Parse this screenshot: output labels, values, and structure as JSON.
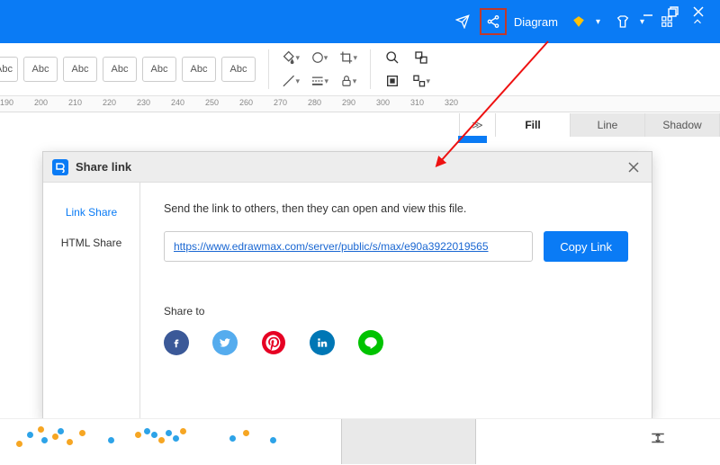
{
  "titlebar": {
    "diagram_label": "Diagram"
  },
  "toolbar": {
    "abc_label": "Abc"
  },
  "ruler": {
    "ticks": [
      "190",
      "200",
      "210",
      "220",
      "230",
      "240",
      "250",
      "260",
      "270",
      "280",
      "290",
      "300",
      "310",
      "320"
    ]
  },
  "right_tabs": {
    "expand": "≫",
    "fill": "Fill",
    "line": "Line",
    "shadow": "Shadow"
  },
  "dialog": {
    "title": "Share link",
    "side": {
      "link_share": "Link Share",
      "html_share": "HTML Share"
    },
    "instruction": "Send the link to others, then they can open and view this file.",
    "link_value": "https://www.edrawmax.com/server/public/s/max/e90a3922019565",
    "copy_label": "Copy Link",
    "share_to_label": "Share to"
  }
}
